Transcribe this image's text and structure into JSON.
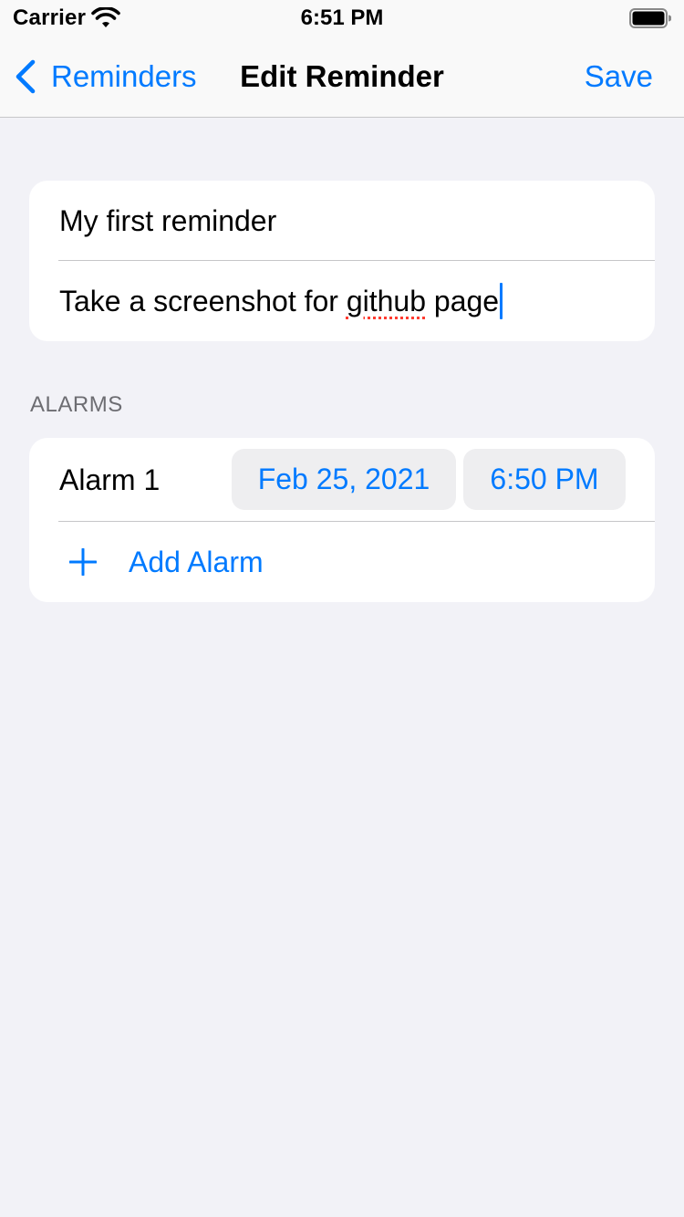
{
  "status_bar": {
    "carrier": "Carrier",
    "time": "6:51 PM",
    "wifi_icon": "wifi-icon",
    "battery_icon": "battery-full-icon"
  },
  "nav": {
    "back_label": "Reminders",
    "back_icon": "chevron-left-icon",
    "title": "Edit Reminder",
    "save_label": "Save"
  },
  "reminder": {
    "title": "My first reminder",
    "note_before": "Take a screenshot for ",
    "note_misspelled": "github",
    "note_after": " page"
  },
  "alarms": {
    "section_header": "ALARMS",
    "items": [
      {
        "label": "Alarm 1",
        "date": "Feb 25, 2021",
        "time": "6:50 PM"
      }
    ],
    "add_label": "Add Alarm",
    "add_icon": "plus-icon"
  },
  "colors": {
    "accent": "#007aff",
    "background": "#f2f2f7",
    "card": "#ffffff",
    "secondary_text": "#6d6d72",
    "pill_background": "#eeeef0",
    "spellcheck": "#ff3b30"
  }
}
